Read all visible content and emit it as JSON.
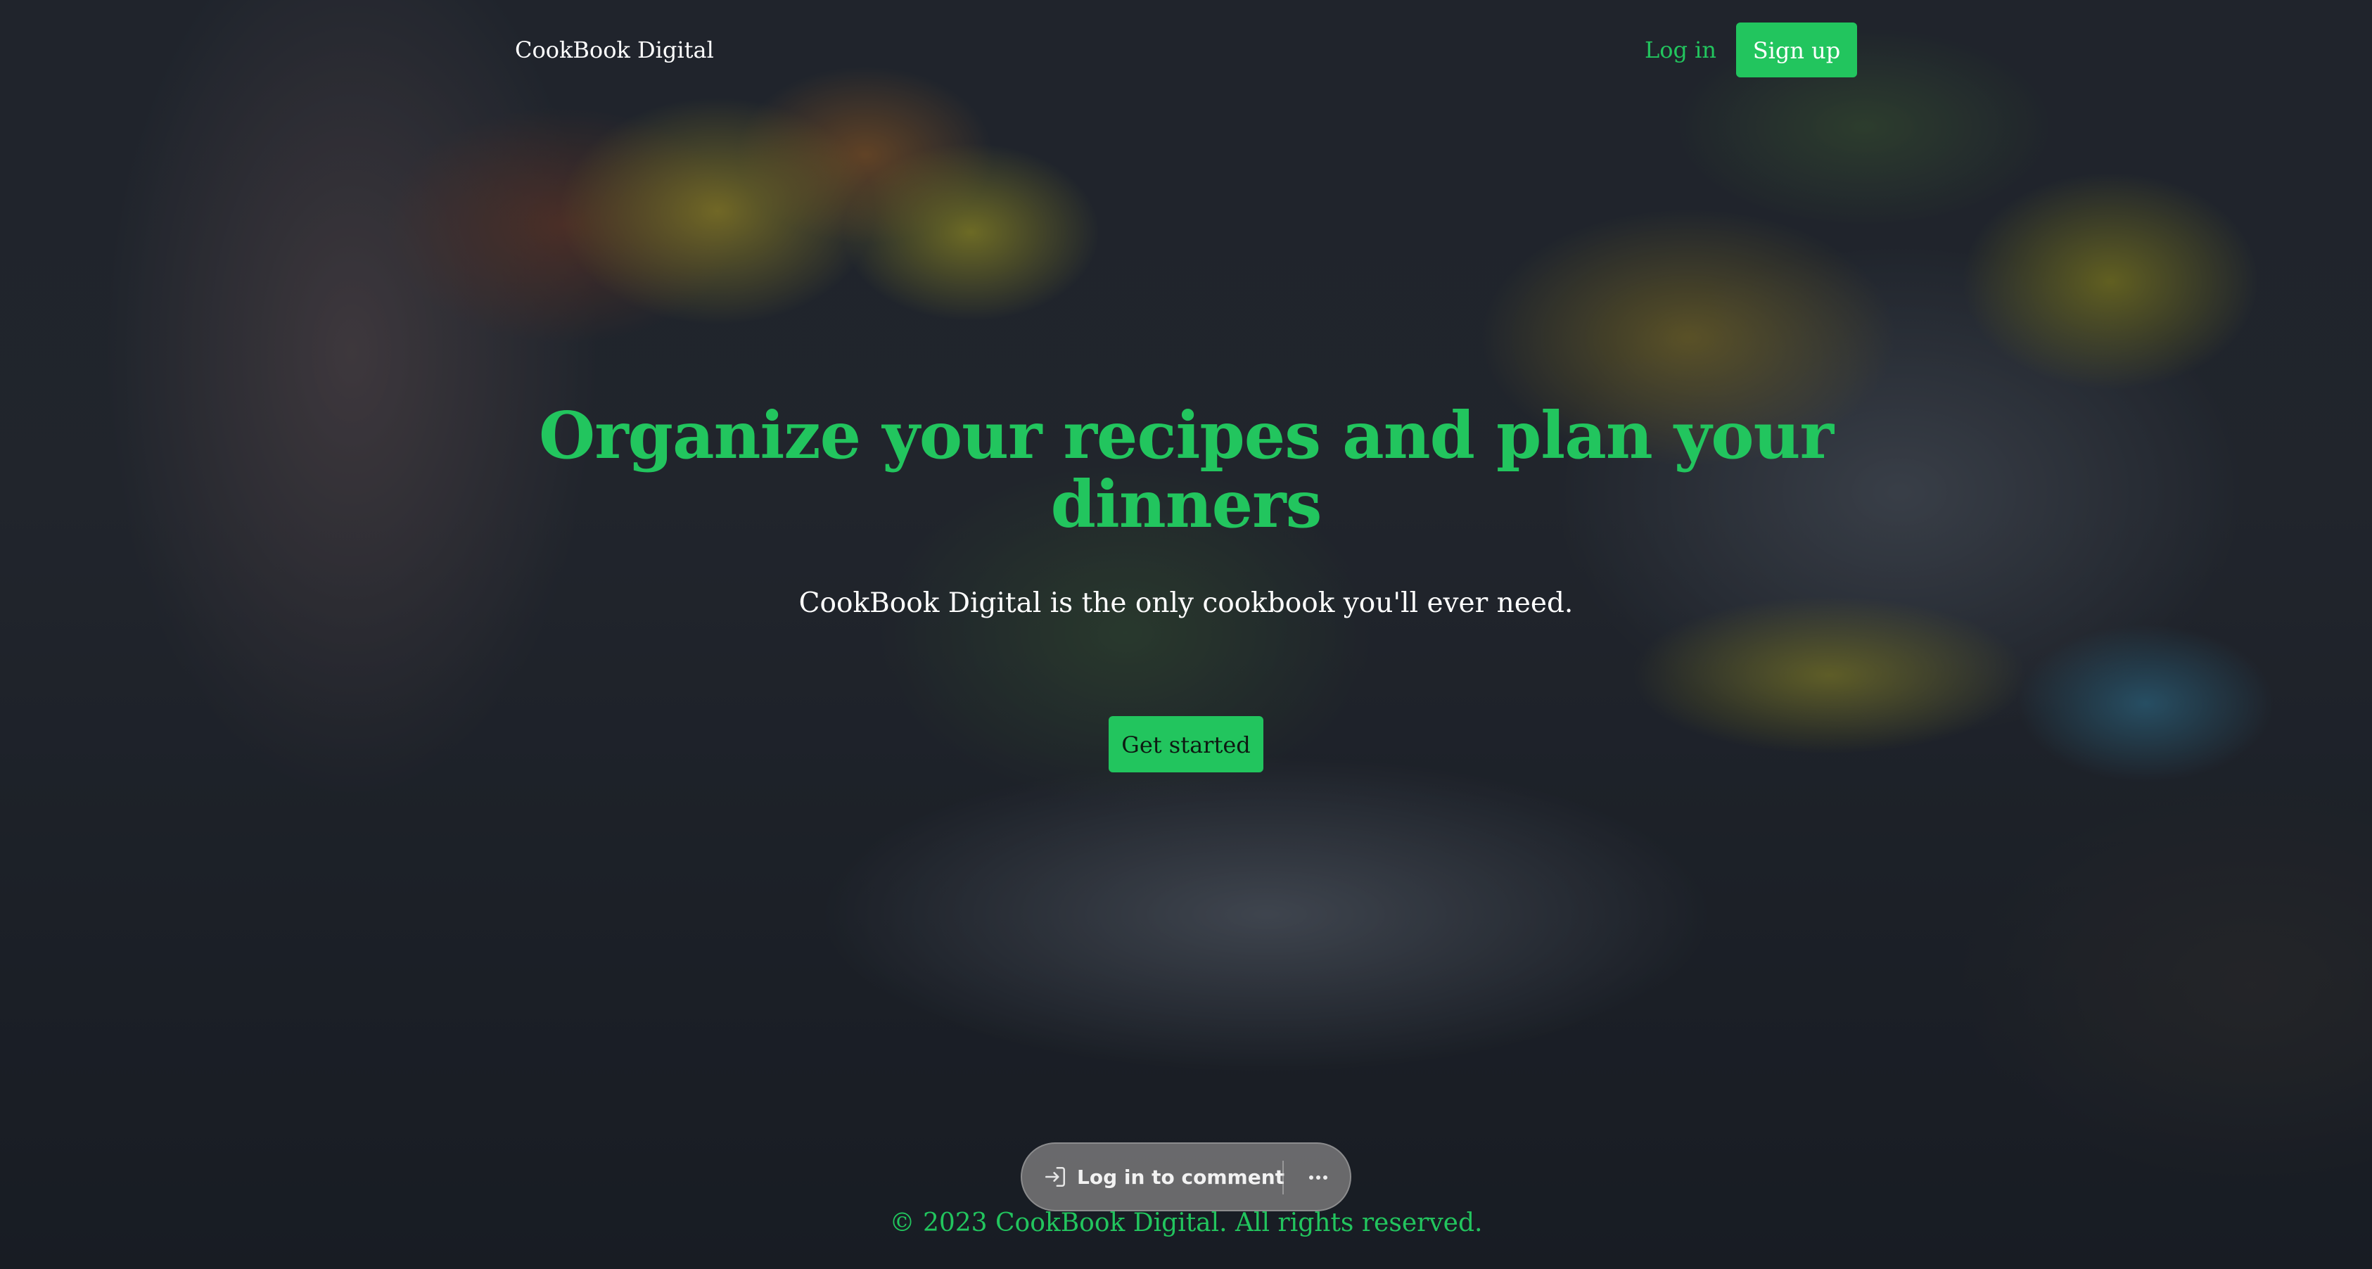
{
  "header": {
    "brand": "CookBook Digital",
    "login_label": "Log in",
    "signup_label": "Sign up"
  },
  "hero": {
    "title": "Organize your recipes and plan your dinners",
    "subtitle": "CookBook Digital is the only cookbook you'll ever need.",
    "cta_label": "Get started"
  },
  "comment_bar": {
    "login_label": "Log in to comment",
    "login_icon": "sign-in-icon",
    "more_icon": "more-horizontal-icon"
  },
  "footer": {
    "copyright": "© 2023 CookBook Digital. All rights reserved."
  },
  "colors": {
    "accent": "#22c55e",
    "text_light": "#ffffff",
    "overlay": "#141820"
  }
}
